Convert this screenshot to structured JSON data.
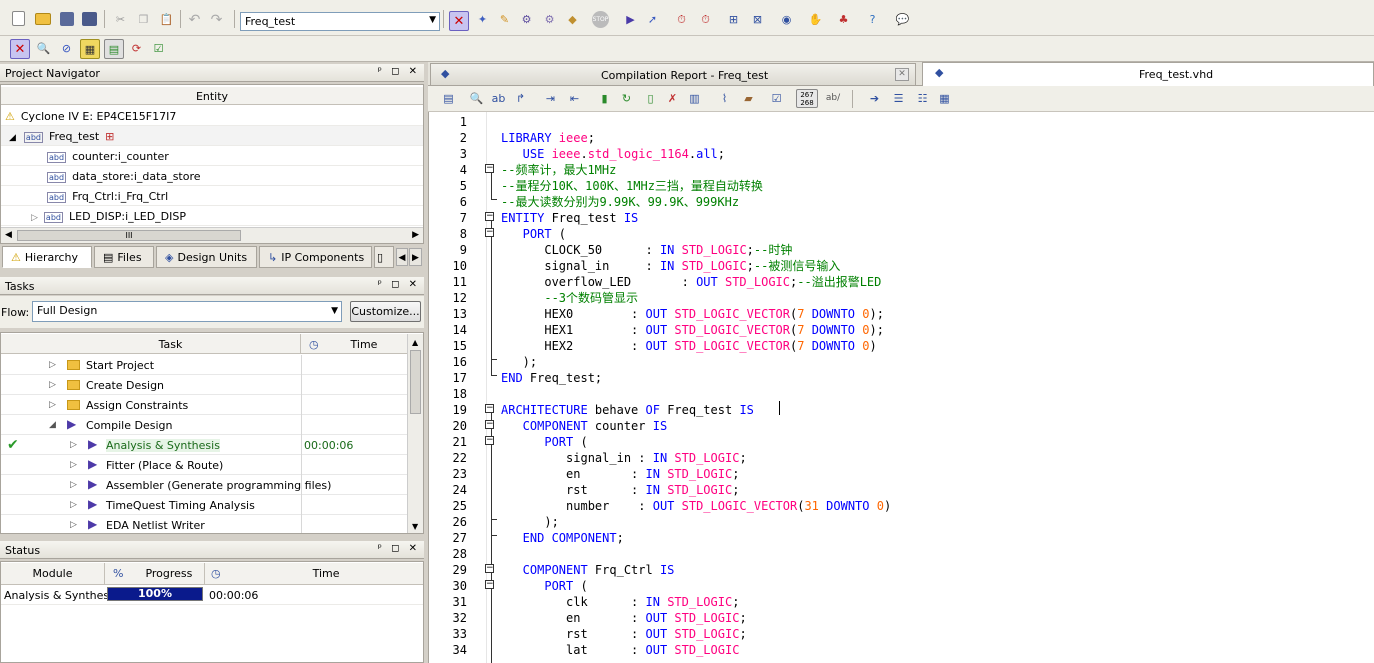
{
  "toolbar": {
    "project_combo": "Freq_test",
    "row1_icons": [
      "new-icon",
      "open-icon",
      "save-icon",
      "save-all-icon",
      "cut-icon",
      "copy-icon",
      "paste-icon",
      "undo-icon",
      "redo-icon"
    ],
    "row1_right_icons": [
      "chip-planner-icon",
      "pin-planner-icon",
      "pencil-icon",
      "settings-icon",
      "compile-icon",
      "stop-icon",
      "start-compilation-icon",
      "analysis-icon",
      "timing-icon",
      "clock-icon",
      "netlist-icon",
      "rtl-viewer-icon",
      "programmer-icon",
      "hand-icon",
      "chip-icon",
      "help-icon",
      "feedback-icon"
    ],
    "row2_icons": [
      "chip-planner-icon",
      "find-icon",
      "assignment-icon",
      "pin-planner-icon",
      "grid-icon",
      "refresh-icon",
      "check-icon"
    ]
  },
  "project_navigator": {
    "title": "Project Navigator",
    "column_header": "Entity",
    "device": "Cyclone IV E: EP4CE15F17I7",
    "top_entity": "Freq_test",
    "children": [
      {
        "label": "counter:i_counter"
      },
      {
        "label": "data_store:i_data_store"
      },
      {
        "label": "Frq_Ctrl:i_Frq_Ctrl"
      },
      {
        "label": "LED_DISP:i_LED_DISP"
      }
    ],
    "scroll_grip": "III",
    "tabs": [
      "Hierarchy",
      "Files",
      "Design Units",
      "IP Components"
    ]
  },
  "tasks": {
    "title": "Tasks",
    "flow_label": "Flow:",
    "flow_value": "Full Design",
    "customize_label": "Customize...",
    "col_task": "Task",
    "col_time": "Time",
    "rows": [
      {
        "label": "Start Project",
        "time": "",
        "kind": "folder",
        "done": false,
        "expanded": false,
        "indent": 0
      },
      {
        "label": "Create Design",
        "time": "",
        "kind": "folder",
        "done": false,
        "expanded": false,
        "indent": 0
      },
      {
        "label": "Assign Constraints",
        "time": "",
        "kind": "folder",
        "done": false,
        "expanded": false,
        "indent": 0
      },
      {
        "label": "Compile Design",
        "time": "",
        "kind": "run",
        "done": false,
        "expanded": true,
        "indent": 0
      },
      {
        "label": "Analysis & Synthesis",
        "time": "00:00:06",
        "kind": "run",
        "done": true,
        "expanded": false,
        "indent": 1
      },
      {
        "label": "Fitter (Place & Route)",
        "time": "",
        "kind": "run",
        "done": false,
        "expanded": false,
        "indent": 1
      },
      {
        "label": "Assembler (Generate programming files)",
        "time": "",
        "kind": "run",
        "done": false,
        "expanded": false,
        "indent": 1
      },
      {
        "label": "TimeQuest Timing Analysis",
        "time": "",
        "kind": "run",
        "done": false,
        "expanded": false,
        "indent": 1
      },
      {
        "label": "EDA Netlist Writer",
        "time": "",
        "kind": "run",
        "done": false,
        "expanded": false,
        "indent": 1
      }
    ]
  },
  "status": {
    "title": "Status",
    "col_module": "Module",
    "col_pct": "%",
    "col_progress": "Progress",
    "col_time": "Time",
    "rows": [
      {
        "module": "Analysis & Synthesis",
        "progress": "100%",
        "progress_fraction": 1.0,
        "time": "00:00:06"
      }
    ]
  },
  "editor_tabs": {
    "compilation_report": "Compilation Report - Freq_test",
    "file_tab": "Freq_test.vhd"
  },
  "editor_toolbar": {
    "line_counter": "267\n268",
    "ab_label": "ab/"
  },
  "code_lines": [
    [],
    [
      {
        "t": "LIBRARY ",
        "c": "kw"
      },
      {
        "t": "ieee",
        "c": "ty"
      },
      {
        "t": ";",
        "c": ""
      }
    ],
    [
      {
        "t": "   USE ",
        "c": "kw"
      },
      {
        "t": "ieee",
        "c": "ty"
      },
      {
        "t": ".",
        "c": ""
      },
      {
        "t": "std_logic_1164",
        "c": "ty"
      },
      {
        "t": ".",
        "c": ""
      },
      {
        "t": "all",
        "c": "kw"
      },
      {
        "t": ";",
        "c": ""
      }
    ],
    [
      {
        "t": "--频率计，最大1MHz",
        "c": "cm"
      }
    ],
    [
      {
        "t": "--量程分10K、100K、1MHz三挡，量程自动转换",
        "c": "cm"
      }
    ],
    [
      {
        "t": "--最大读数分别为9.99K、99.9K、999KHz",
        "c": "cm"
      }
    ],
    [
      {
        "t": "ENTITY ",
        "c": "kw"
      },
      {
        "t": "Freq_test ",
        "c": ""
      },
      {
        "t": "IS",
        "c": "kw"
      }
    ],
    [
      {
        "t": "   PORT ",
        "c": "kw"
      },
      {
        "t": "(",
        "c": ""
      }
    ],
    [
      {
        "t": "      CLOCK_50      : ",
        "c": ""
      },
      {
        "t": "IN ",
        "c": "kw"
      },
      {
        "t": "STD_LOGIC",
        "c": "ty"
      },
      {
        "t": ";",
        "c": ""
      },
      {
        "t": "--时钟",
        "c": "cm"
      }
    ],
    [
      {
        "t": "      signal_in     : ",
        "c": ""
      },
      {
        "t": "IN ",
        "c": "kw"
      },
      {
        "t": "STD_LOGIC",
        "c": "ty"
      },
      {
        "t": ";",
        "c": ""
      },
      {
        "t": "--被测信号输入",
        "c": "cm"
      }
    ],
    [
      {
        "t": "      overflow_LED       : ",
        "c": ""
      },
      {
        "t": "OUT ",
        "c": "kw"
      },
      {
        "t": "STD_LOGIC",
        "c": "ty"
      },
      {
        "t": ";",
        "c": ""
      },
      {
        "t": "--溢出报警LED",
        "c": "cm"
      }
    ],
    [
      {
        "t": "      --3个数码管显示",
        "c": "cm"
      }
    ],
    [
      {
        "t": "      HEX0        : ",
        "c": ""
      },
      {
        "t": "OUT ",
        "c": "kw"
      },
      {
        "t": "STD_LOGIC_VECTOR",
        "c": "ty"
      },
      {
        "t": "(",
        "c": ""
      },
      {
        "t": "7 ",
        "c": "nu"
      },
      {
        "t": "DOWNTO ",
        "c": "kw"
      },
      {
        "t": "0",
        "c": "nu"
      },
      {
        "t": ");",
        "c": ""
      }
    ],
    [
      {
        "t": "      HEX1        : ",
        "c": ""
      },
      {
        "t": "OUT ",
        "c": "kw"
      },
      {
        "t": "STD_LOGIC_VECTOR",
        "c": "ty"
      },
      {
        "t": "(",
        "c": ""
      },
      {
        "t": "7 ",
        "c": "nu"
      },
      {
        "t": "DOWNTO ",
        "c": "kw"
      },
      {
        "t": "0",
        "c": "nu"
      },
      {
        "t": ");",
        "c": ""
      }
    ],
    [
      {
        "t": "      HEX2        : ",
        "c": ""
      },
      {
        "t": "OUT ",
        "c": "kw"
      },
      {
        "t": "STD_LOGIC_VECTOR",
        "c": "ty"
      },
      {
        "t": "(",
        "c": ""
      },
      {
        "t": "7 ",
        "c": "nu"
      },
      {
        "t": "DOWNTO ",
        "c": "kw"
      },
      {
        "t": "0",
        "c": "nu"
      },
      {
        "t": ")",
        "c": ""
      }
    ],
    [
      {
        "t": "   );",
        "c": ""
      }
    ],
    [
      {
        "t": "END ",
        "c": "kw"
      },
      {
        "t": "Freq_test;",
        "c": ""
      }
    ],
    [],
    [
      {
        "t": "ARCHITECTURE ",
        "c": "kw"
      },
      {
        "t": "behave ",
        "c": ""
      },
      {
        "t": "OF ",
        "c": "kw"
      },
      {
        "t": "Freq_test ",
        "c": ""
      },
      {
        "t": "IS",
        "c": "kw"
      }
    ],
    [
      {
        "t": "   COMPONENT ",
        "c": "kw"
      },
      {
        "t": "counter ",
        "c": ""
      },
      {
        "t": "IS",
        "c": "kw"
      }
    ],
    [
      {
        "t": "      PORT ",
        "c": "kw"
      },
      {
        "t": "(",
        "c": ""
      }
    ],
    [
      {
        "t": "         signal_in : ",
        "c": ""
      },
      {
        "t": "IN ",
        "c": "kw"
      },
      {
        "t": "STD_LOGIC",
        "c": "ty"
      },
      {
        "t": ";",
        "c": ""
      }
    ],
    [
      {
        "t": "         en       : ",
        "c": ""
      },
      {
        "t": "IN ",
        "c": "kw"
      },
      {
        "t": "STD_LOGIC",
        "c": "ty"
      },
      {
        "t": ";",
        "c": ""
      }
    ],
    [
      {
        "t": "         rst      : ",
        "c": ""
      },
      {
        "t": "IN ",
        "c": "kw"
      },
      {
        "t": "STD_LOGIC",
        "c": "ty"
      },
      {
        "t": ";",
        "c": ""
      }
    ],
    [
      {
        "t": "         number    : ",
        "c": ""
      },
      {
        "t": "OUT ",
        "c": "kw"
      },
      {
        "t": "STD_LOGIC_VECTOR",
        "c": "ty"
      },
      {
        "t": "(",
        "c": ""
      },
      {
        "t": "31 ",
        "c": "nu"
      },
      {
        "t": "DOWNTO ",
        "c": "kw"
      },
      {
        "t": "0",
        "c": "nu"
      },
      {
        "t": ")",
        "c": ""
      }
    ],
    [
      {
        "t": "      );",
        "c": ""
      }
    ],
    [
      {
        "t": "   END COMPONENT",
        "c": "kw"
      },
      {
        "t": ";",
        "c": ""
      }
    ],
    [],
    [
      {
        "t": "   COMPONENT ",
        "c": "kw"
      },
      {
        "t": "Frq_Ctrl ",
        "c": ""
      },
      {
        "t": "IS",
        "c": "kw"
      }
    ],
    [
      {
        "t": "      PORT ",
        "c": "kw"
      },
      {
        "t": "(",
        "c": ""
      }
    ],
    [
      {
        "t": "         clk      : ",
        "c": ""
      },
      {
        "t": "IN ",
        "c": "kw"
      },
      {
        "t": "STD_LOGIC",
        "c": "ty"
      },
      {
        "t": ";",
        "c": ""
      }
    ],
    [
      {
        "t": "         en       : ",
        "c": ""
      },
      {
        "t": "OUT ",
        "c": "kw"
      },
      {
        "t": "STD_LOGIC",
        "c": "ty"
      },
      {
        "t": ";",
        "c": ""
      }
    ],
    [
      {
        "t": "         rst      : ",
        "c": ""
      },
      {
        "t": "OUT ",
        "c": "kw"
      },
      {
        "t": "STD_LOGIC",
        "c": "ty"
      },
      {
        "t": ";",
        "c": ""
      }
    ],
    [
      {
        "t": "         lat      : ",
        "c": ""
      },
      {
        "t": "OUT ",
        "c": "kw"
      },
      {
        "t": "STD_LOGIC",
        "c": "ty"
      }
    ],
    [
      {
        "t": "      );",
        "c": ""
      }
    ]
  ],
  "colors": {
    "keyword": "#0000ff",
    "type": "#ff0080",
    "comment": "#008000",
    "number": "#ff6600",
    "progress_bar": "#0a1a8c"
  }
}
